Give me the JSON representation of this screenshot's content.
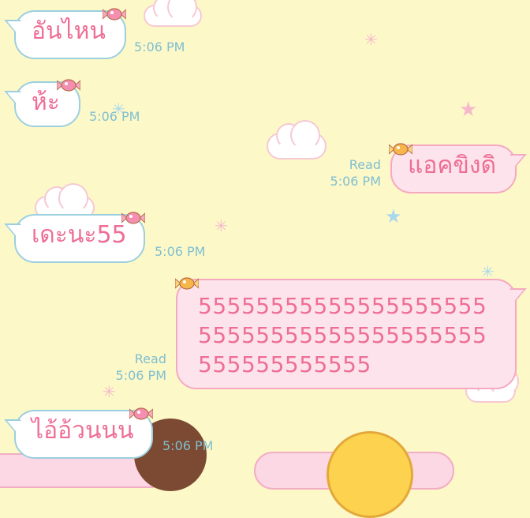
{
  "colors": {
    "background": "#fdf8c8",
    "incoming_border": "#9ccfdf",
    "outgoing_bg": "#fde4ec",
    "message_text": "#ee6e96",
    "meta_text": "#7fbfd1"
  },
  "messages": [
    {
      "direction": "incoming",
      "text": "อันไหน",
      "time": "5:06 PM"
    },
    {
      "direction": "incoming",
      "text": "ห้ะ",
      "time": "5:06 PM"
    },
    {
      "direction": "outgoing",
      "text": "แอคขิงดิ",
      "read": "Read",
      "time": "5:06 PM"
    },
    {
      "direction": "incoming",
      "text": "เดะนะ55",
      "time": "5:06 PM"
    },
    {
      "direction": "outgoing",
      "text": "5555555555555555555555555555555555555555555555555555",
      "read": "Read",
      "time": "5:06 PM"
    },
    {
      "direction": "incoming",
      "text": "ไอ้อ้วนนน",
      "time": "5:06 PM"
    }
  ]
}
